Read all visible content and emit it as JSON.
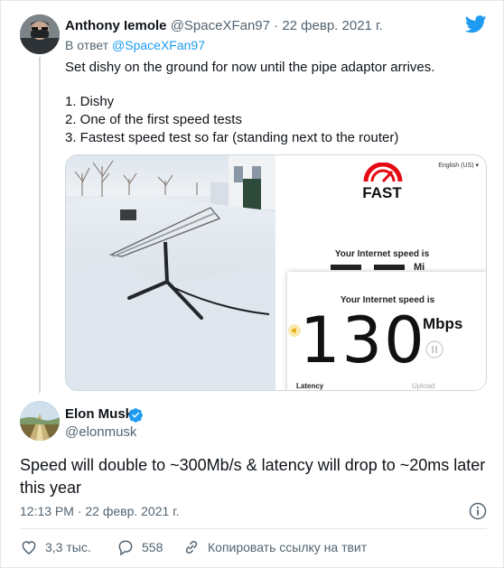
{
  "reply_tweet": {
    "author_name": "Anthony Iemole",
    "author_handle": "@SpaceXFan97",
    "separator": "·",
    "date": "22 февр. 2021 г.",
    "reply_prefix": "В ответ",
    "reply_handle": "@SpaceXFan97",
    "lines": [
      "Set dishy on the ground for now until the pipe adaptor arrives.",
      "1. Dishy",
      "2. One of the first speed tests",
      "3. Fastest speed test so far (standing next to the router)"
    ],
    "media": {
      "speedtest": {
        "language": "English (US)",
        "logo": "FAST",
        "speed_label": "Your Internet speed is",
        "speed_value": "130",
        "speed_unit": "Mbps",
        "partial_unit": "Mi",
        "latency_label": "Latency",
        "upload_label": "Upload"
      }
    }
  },
  "main_tweet": {
    "author_name": "Elon Musk",
    "author_handle": "@elonmusk",
    "text": "Speed will double to ~300Mb/s & latency will drop to ~20ms later this year",
    "timestamp": "12:13 PM · 22 февр. 2021 г."
  },
  "actions": {
    "likes": "3,3 тыс.",
    "replies": "558",
    "copy_link": "Копировать ссылку на твит"
  },
  "icons": {
    "brand": "twitter-bird-icon",
    "verified": "verified-badge-icon",
    "info": "info-icon",
    "like": "heart-icon",
    "reply": "reply-bubble-icon",
    "link": "link-icon"
  },
  "colors": {
    "brand_blue": "#1d9bf0",
    "text": "#0f1419",
    "muted": "#536471",
    "fast_red": "#e50914"
  }
}
